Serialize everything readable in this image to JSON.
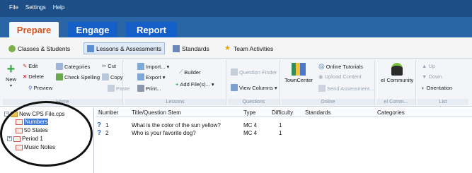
{
  "menu": [
    "File",
    "Settings",
    "Help"
  ],
  "main_tabs": [
    {
      "label": "Prepare",
      "active": true
    },
    {
      "label": "Engage",
      "active": false
    },
    {
      "label": "Report",
      "active": false
    }
  ],
  "sub_tabs": [
    {
      "label": "Classes & Students",
      "active": false
    },
    {
      "label": "Lessons & Assessments",
      "active": true
    },
    {
      "label": "Standards",
      "active": false
    },
    {
      "label": "Team Activities",
      "active": false
    }
  ],
  "ribbon": {
    "home": {
      "label": "Home",
      "new": "New",
      "edit": "Edit",
      "delete": "Delete",
      "preview": "Preview",
      "categories": "Categories",
      "check_spelling": "Check Spelling",
      "paste": "Paste",
      "cut": "Cut",
      "copy": "Copy"
    },
    "lessons": {
      "label": "Lessons",
      "import": "Import...",
      "export": "Export",
      "print": "Print...",
      "builder": "Builder",
      "add_files": "Add File(s)..."
    },
    "questions": {
      "label": "Questions",
      "question_finder": "Question Finder",
      "view_columns": "View Columns"
    },
    "online": {
      "label": "Online",
      "towncenter": "TownCenter",
      "online_tutorials": "Online Tutorials",
      "upload_content": "Upload Content",
      "send_assessment": "Send Assessment..."
    },
    "community": {
      "label": "eI Comm...",
      "ei_community": "eI Community"
    },
    "list": {
      "label": "List",
      "up": "Up",
      "down": "Down",
      "orientation": "Orientation"
    }
  },
  "tree": {
    "root": "New CPS File.cps",
    "children": [
      "Numbers",
      "50 States",
      "Period 1",
      "Music Notes"
    ],
    "selected": "Numbers"
  },
  "table": {
    "headers": [
      "Number",
      "Title/Question Stem",
      "Type",
      "Difficulty",
      "Standards",
      "Categories"
    ],
    "rows": [
      {
        "number": "1",
        "stem": "What is the color of the sun yellow?",
        "type": "MC 4",
        "difficulty": "1"
      },
      {
        "number": "2",
        "stem": "Who is your favorite dog?",
        "type": "MC 4",
        "difficulty": "1"
      }
    ]
  },
  "colors": {
    "menubar": "#1d4f86",
    "tabrow": "#2a66a6",
    "prepare_text": "#d9531e",
    "selection": "#3b78d8"
  }
}
